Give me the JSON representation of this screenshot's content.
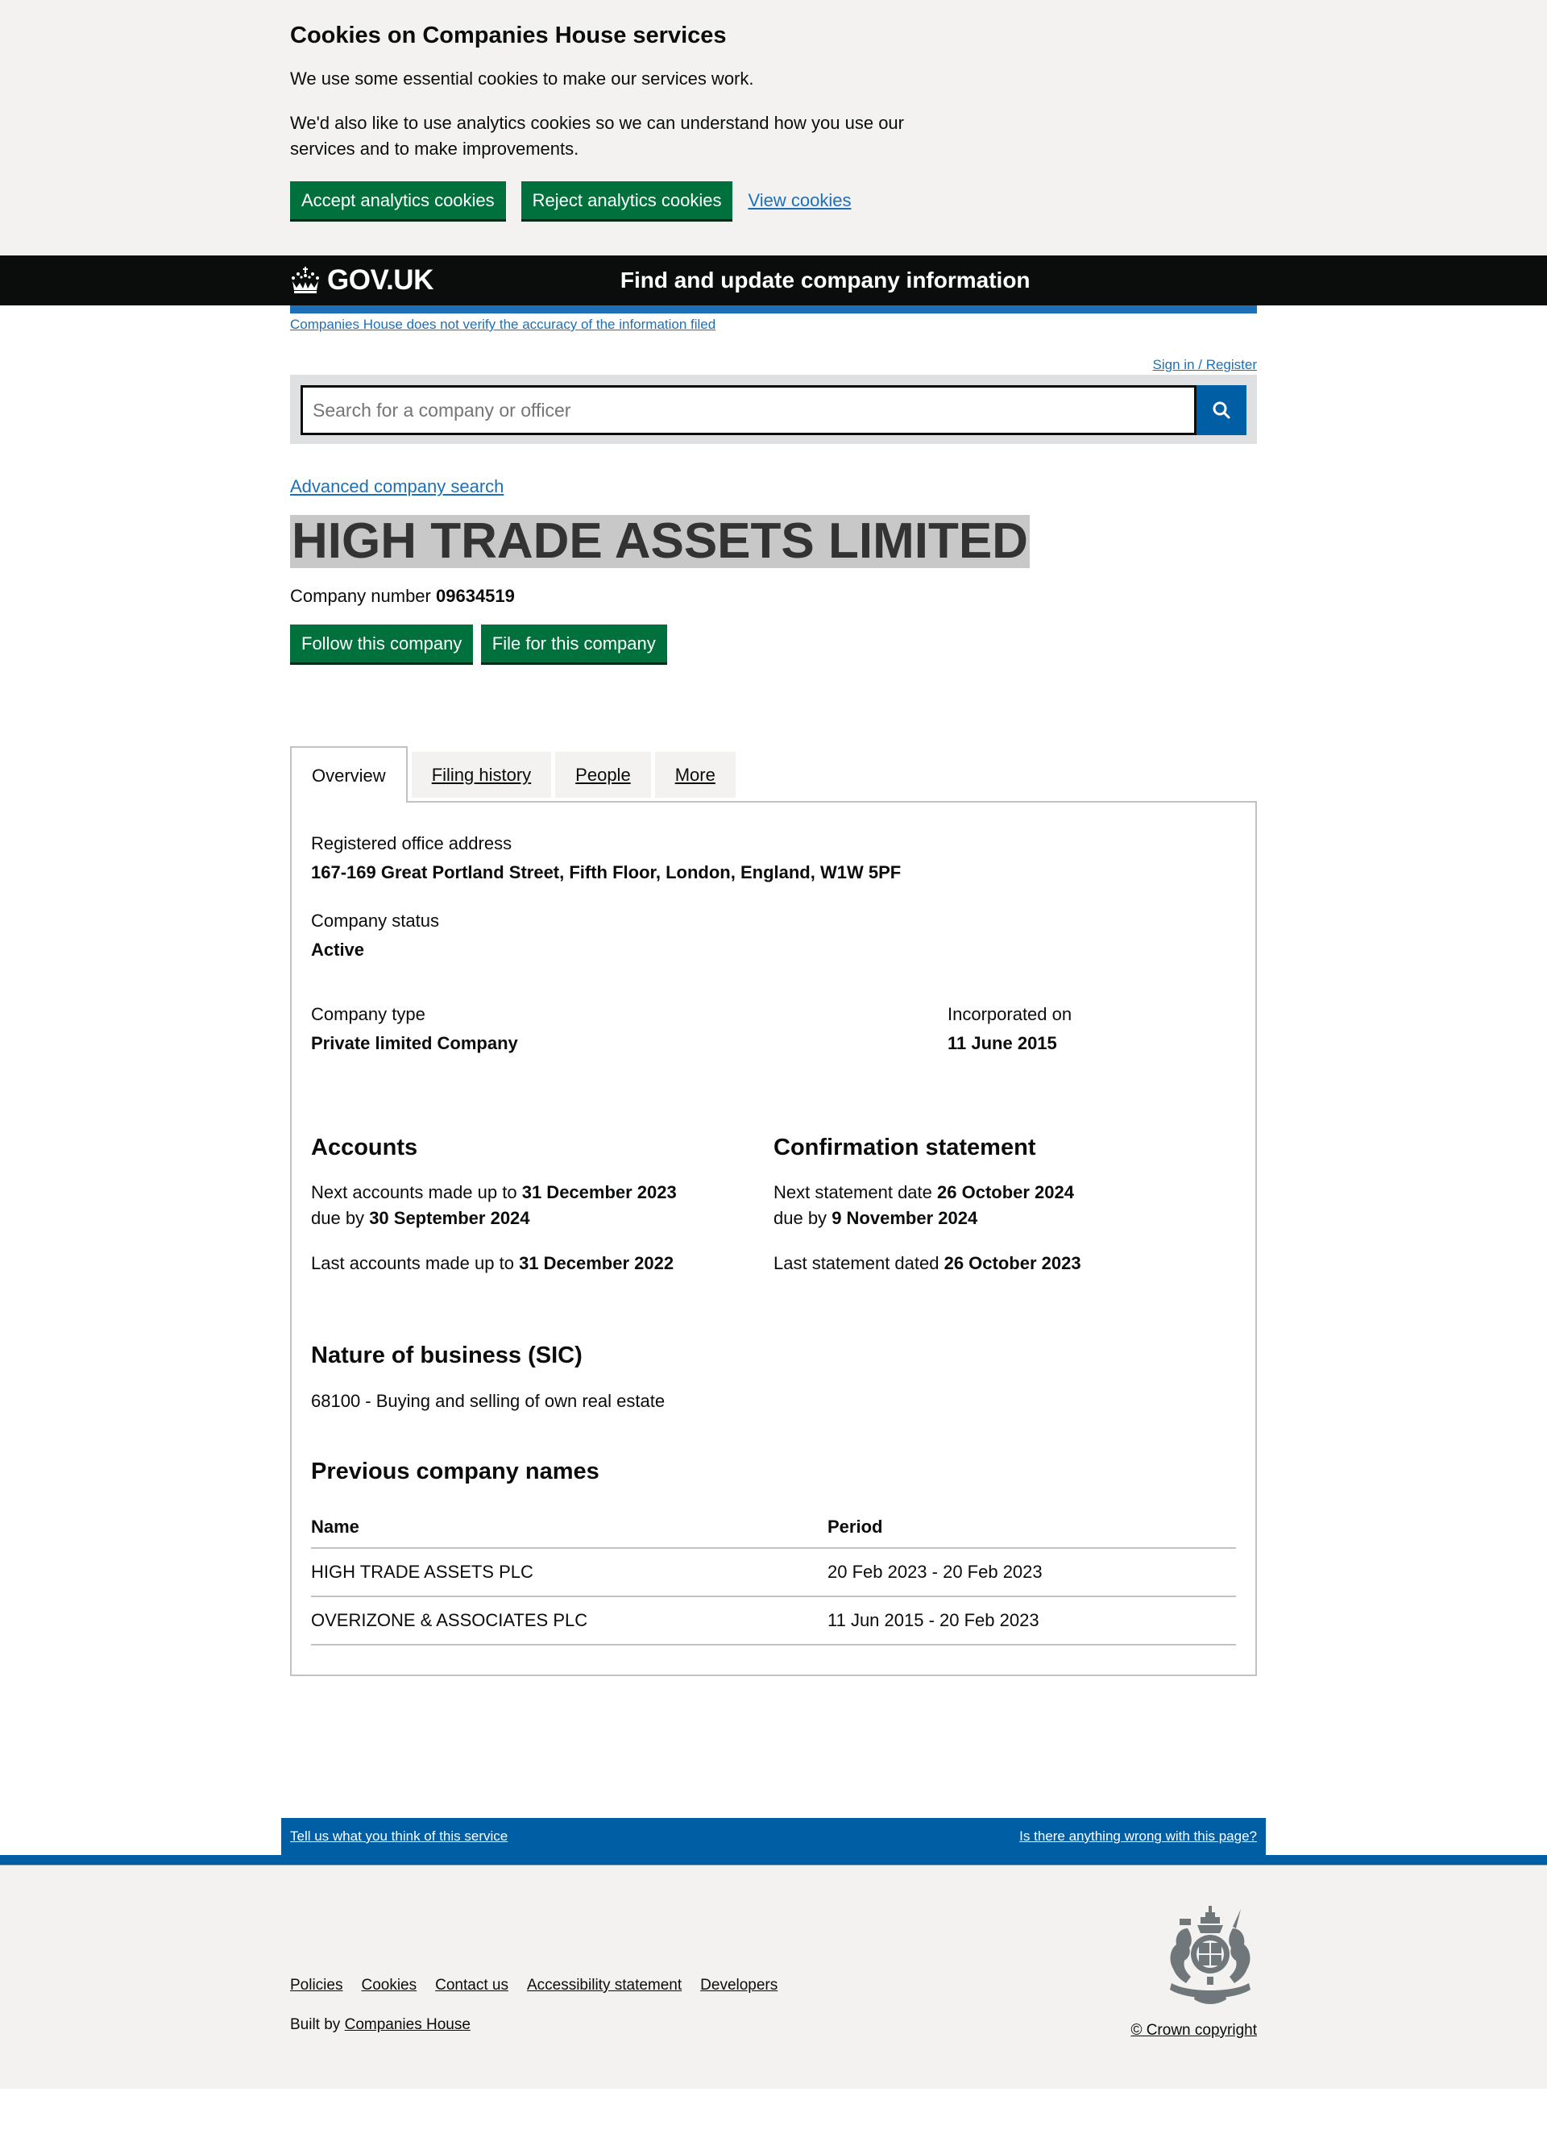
{
  "cookie_banner": {
    "title": "Cookies on Companies House services",
    "paragraph_1": "We use some essential cookies to make our services work.",
    "paragraph_2": "We'd also like to use analytics cookies so we can understand how you use our services and to make improvements.",
    "accept_label": "Accept analytics cookies",
    "reject_label": "Reject analytics cookies",
    "view_label": "View cookies"
  },
  "header": {
    "logo_text": "GOV.UK",
    "service_name": "Find and update company information",
    "disclaimer": "Companies House does not verify the accuracy of the information filed",
    "sign_in": "Sign in / Register"
  },
  "search": {
    "placeholder": "Search for a company or officer",
    "button_icon": "search-icon"
  },
  "advanced_search": "Advanced company search",
  "company": {
    "name": "HIGH TRADE ASSETS LIMITED",
    "number_label": "Company number",
    "number": "09634519",
    "follow_label": "Follow this company",
    "file_label": "File for this company"
  },
  "tabs": [
    {
      "label": "Overview",
      "active": true
    },
    {
      "label": "Filing history",
      "active": false
    },
    {
      "label": "People",
      "active": false
    },
    {
      "label": "More",
      "active": false
    }
  ],
  "overview": {
    "address_label": "Registered office address",
    "address": "167-169 Great Portland Street, Fifth Floor, London, England, W1W 5PF",
    "status_label": "Company status",
    "status": "Active",
    "type_label": "Company type",
    "type": "Private limited Company",
    "incorporated_label": "Incorporated on",
    "incorporated": "11 June 2015"
  },
  "accounts": {
    "title": "Accounts",
    "next_prefix": "Next accounts made up to",
    "next_date": "31 December 2023",
    "due_prefix": "due by",
    "due_date": "30 September 2024",
    "last_prefix": "Last accounts made up to",
    "last_date": "31 December 2022"
  },
  "confirmation": {
    "title": "Confirmation statement",
    "next_prefix": "Next statement date",
    "next_date": "26 October 2024",
    "due_prefix": "due by",
    "due_date": "9 November 2024",
    "last_prefix": "Last statement dated",
    "last_date": "26 October 2023"
  },
  "sic": {
    "title": "Nature of business (SIC)",
    "item": "68100 - Buying and selling of own real estate"
  },
  "previous_names": {
    "title": "Previous company names",
    "headers": [
      "Name",
      "Period"
    ],
    "rows": [
      {
        "name": "HIGH TRADE ASSETS PLC",
        "period": "20 Feb 2023 - 20 Feb 2023"
      },
      {
        "name": "OVERIZONE & ASSOCIATES PLC",
        "period": "11 Jun 2015 - 20 Feb 2023"
      }
    ]
  },
  "feedback": {
    "left": "Tell us what you think of this service",
    "right": "Is there anything wrong with this page?"
  },
  "footer": {
    "links": [
      "Policies",
      "Cookies",
      "Contact us",
      "Accessibility statement",
      "Developers"
    ],
    "built_by_prefix": "Built by",
    "built_by_link": "Companies House",
    "copyright": "© Crown copyright"
  },
  "colors": {
    "button_green": "#00703c",
    "link_blue": "#1d70b8",
    "header_black": "#0b0c0c",
    "feedback_blue": "#005ea5",
    "banner_grey": "#f3f2f1"
  }
}
